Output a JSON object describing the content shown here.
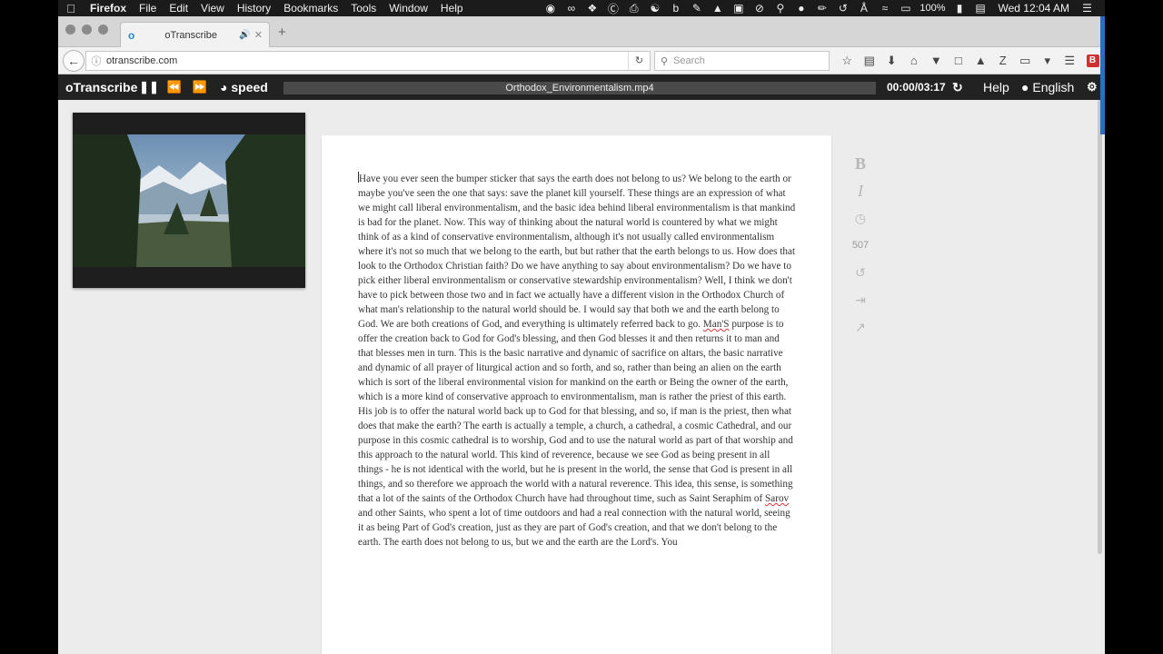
{
  "menubar": {
    "app_name": "Firefox",
    "items": [
      "File",
      "Edit",
      "View",
      "History",
      "Bookmarks",
      "Tools",
      "Window",
      "Help"
    ],
    "battery": "100%",
    "clock": "Wed 12:04 AM"
  },
  "browser": {
    "tab_title": "oTranscribe",
    "url": "otranscribe.com",
    "search_placeholder": "Search"
  },
  "otranscribe": {
    "brand": "oTranscribe",
    "speed_label": "speed",
    "filename": "Orthodox_Environmentalism.mp4",
    "time": "00:00/03:17",
    "help_label": "Help",
    "language_label": "English",
    "word_count": "507"
  },
  "transcript": {
    "part1": "Have you ever seen the bumper sticker that says the earth does not belong to us? We belong to the earth or maybe you've seen the one that says: save the planet kill yourself. These things are an expression of what we might call liberal environmentalism, and the basic idea behind liberal environmentalism is that mankind is bad for the planet. Now. This way of thinking about the natural world is countered by what we might think of as a kind of conservative environmentalism, although it's not usually called environmentalism where it's not so much that we belong to the earth, but but rather that the earth belongs to us. How does that look to the Orthodox Christian faith? Do we have anything to say about environmentalism? Do we have to pick either liberal environmentalism or conservative stewardship environmentalism? Well, I think we don't have to pick between those two and in fact we actually have a different vision in the Orthodox Church of what man's relationship to the natural world should be. I would say that both we and the earth belong to God. We are both creations of God, and everything is ultimately referred back to go. ",
    "misspelled1": "Man'S",
    "part2": " purpose is to offer the creation back to God for God's blessing, and then God blesses it and then returns it to man and that blesses men in turn. This is the basic narrative and dynamic of sacrifice on altars, the basic narrative and dynamic of all prayer of liturgical action and so forth, and so, rather than being an alien on the earth which is sort of the liberal environmental vision for mankind on the earth or Being the owner of the earth, which is a more kind of conservative approach to environmentalism, man is rather the priest of this earth. His job is to offer the natural world back up to God for that blessing, and so, if man is the priest, then what does that make the earth? The earth is actually a temple, a church, a cathedral, a cosmic Cathedral, and our purpose in this cosmic cathedral is to worship, God and to use the natural world as part of that worship and this approach to the natural world. This kind of reverence, because we see God as being present in all things - he is not identical with the world, but he is present in the world, the sense that God is present in all things, and so therefore we approach the world with a natural reverence. This idea, this sense, is something that a lot of the saints of the Orthodox Church have had throughout time, such as Saint Seraphim of ",
    "misspelled2": "Sarov",
    "part3": " and other Saints, who spent a lot of time outdoors and had a real connection with the natural world, seeing it as being Part of God's creation, just as they are part of God's creation, and that we don't belong to the earth. The earth does not belong to us, but we and the earth are the Lord's. You"
  },
  "format_tools": {
    "bold_label": "B",
    "italic_label": "I"
  }
}
